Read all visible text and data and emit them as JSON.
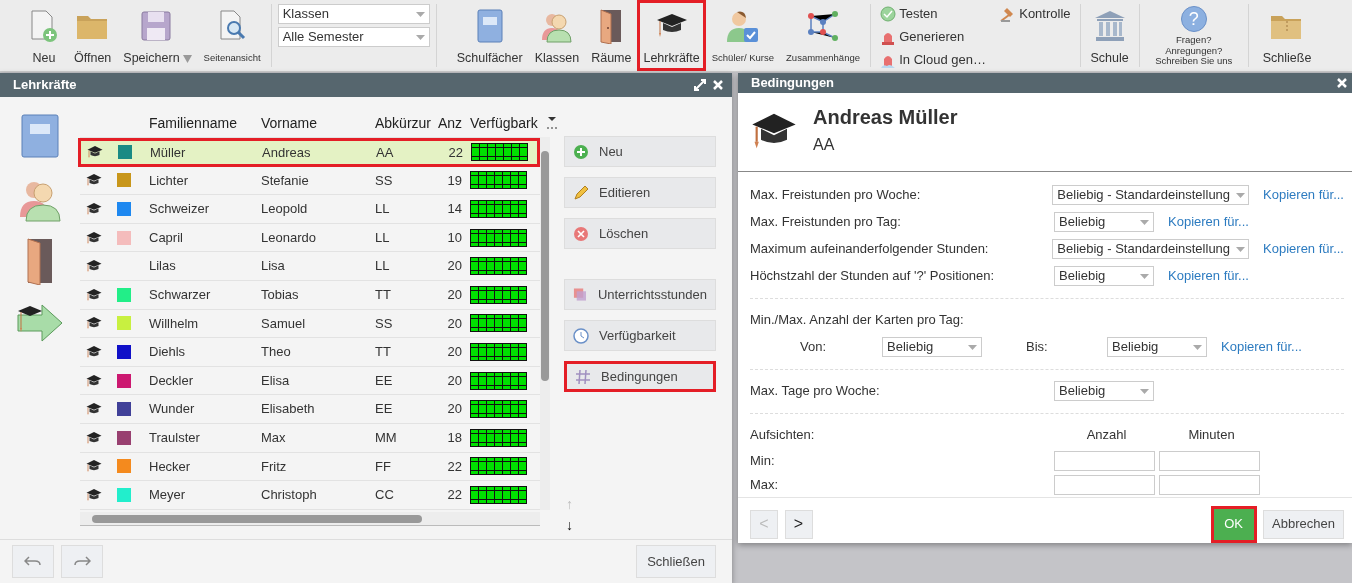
{
  "toolbar": {
    "file_buttons": [
      {
        "label": "Neu",
        "kind": "large",
        "dropdown": false
      },
      {
        "label": "Öffnen",
        "kind": "large",
        "dropdown": false
      },
      {
        "label": "Speichern",
        "kind": "large",
        "dropdown": true
      },
      {
        "label": "Seitenansicht",
        "kind": "small",
        "dropdown": false
      }
    ],
    "filters": [
      {
        "value": "Klassen"
      },
      {
        "value": "Alle Semester"
      }
    ],
    "view_buttons": [
      {
        "label": "Schulfächer",
        "kind": "large",
        "highlighted": false
      },
      {
        "label": "Klassen",
        "kind": "large",
        "highlighted": false
      },
      {
        "label": "Räume",
        "kind": "large",
        "highlighted": false
      },
      {
        "label": "Lehrkräfte",
        "kind": "large",
        "highlighted": true
      },
      {
        "label": "Schüler/ Kurse",
        "kind": "small",
        "highlighted": false
      },
      {
        "label": "Zusammenhänge",
        "kind": "small",
        "highlighted": false
      }
    ],
    "actions": [
      {
        "label": "Testen"
      },
      {
        "label": "Generieren"
      },
      {
        "label": "In Cloud gen…"
      },
      {
        "label": "Kontrolle"
      }
    ],
    "school": "Schule",
    "help_icon": "?",
    "feedback_lines": [
      "Fragen?",
      "Anregungen?",
      "Schreiben Sie uns"
    ],
    "close": "Schließe"
  },
  "teachers_window": {
    "title": "Lehrkräfte",
    "columns": [
      "Familienname",
      "Vorname",
      "Abkürzur",
      "Anz",
      "Verfügbark"
    ],
    "rows": [
      {
        "last": "Müller",
        "first": "Andreas",
        "short": "AA",
        "count": "22",
        "color": "#1a8a84",
        "selected": true
      },
      {
        "last": "Lichter",
        "first": "Stefanie",
        "short": "SS",
        "count": "19",
        "color": "#c8961a",
        "selected": false
      },
      {
        "last": "Schweizer",
        "first": "Leopold",
        "short": "LL",
        "count": "14",
        "color": "#1e88f0",
        "selected": false
      },
      {
        "last": "Capril",
        "first": "Leonardo",
        "short": "LL",
        "count": "10",
        "color": "#f4bcbc",
        "selected": false
      },
      {
        "last": "Lilas",
        "first": "Lisa",
        "short": "LL",
        "count": "20",
        "selected": false
      },
      {
        "last": "Schwarzer",
        "first": "Tobias",
        "short": "TT",
        "count": "20",
        "color": "#22ee88",
        "selected": false
      },
      {
        "last": "Willhelm",
        "first": "Samuel",
        "short": "SS",
        "count": "20",
        "color": "#c8f040",
        "selected": false
      },
      {
        "last": "Diehls",
        "first": "Theo",
        "short": "TT",
        "count": "20",
        "color": "#1010c8",
        "selected": false
      },
      {
        "last": "Deckler",
        "first": "Elisa",
        "short": "EE",
        "count": "20",
        "color": "#cc1870",
        "selected": false
      },
      {
        "last": "Wunder",
        "first": "Elisabeth",
        "short": "EE",
        "count": "20",
        "color": "#404098",
        "selected": false
      },
      {
        "last": "Traulster",
        "first": "Max",
        "short": "MM",
        "count": "18",
        "color": "#984070",
        "selected": false
      },
      {
        "last": "Hecker",
        "first": "Fritz",
        "short": "FF",
        "count": "22",
        "color": "#f48a1e",
        "selected": false
      },
      {
        "last": "Meyer",
        "first": "Christoph",
        "short": "CC",
        "count": "22",
        "color": "#22eecc",
        "selected": false
      }
    ],
    "actions": [
      {
        "label": "Neu",
        "highlighted": false
      },
      {
        "label": "Editieren",
        "highlighted": false
      },
      {
        "label": "Löschen",
        "highlighted": false
      }
    ],
    "details": [
      {
        "label": "Unterrichtsstunden",
        "highlighted": false
      },
      {
        "label": "Verfügbarkeit",
        "highlighted": false
      },
      {
        "label": "Bedingungen",
        "highlighted": true
      }
    ],
    "order_arrows": [
      {
        "label": "↑",
        "disabled": true
      },
      {
        "label": "↓",
        "disabled": false
      }
    ],
    "close_button": "Schließen"
  },
  "conditions_window": {
    "title": "Bedingungen",
    "teacher_name": "Andreas Müller",
    "teacher_short": "AA",
    "limits": [
      {
        "label": "Max. Freistunden pro Woche:",
        "value": "Beliebig - Standardeinstellung",
        "copy_link": "Kopieren für..."
      },
      {
        "label": "Max. Freistunden pro Tag:",
        "value": "Beliebig",
        "copy_link": "Kopieren für..."
      },
      {
        "label": "Maximum aufeinanderfolgender Stunden:",
        "value": "Beliebig - Standardeinstellung",
        "copy_link": "Kopieren für..."
      },
      {
        "label": "Höchstzahl der Stunden auf '?' Positionen:",
        "value": "Beliebig",
        "copy_link": "Kopieren für..."
      }
    ],
    "cards": {
      "label": "Min./Max. Anzahl der Karten pro Tag:",
      "from_label": "Von:",
      "from_value": "Beliebig",
      "to_label": "Bis:",
      "to_value": "Beliebig",
      "copy_link": "Kopieren für..."
    },
    "days": {
      "label": "Max. Tage pro Woche:",
      "value": "Beliebig"
    },
    "supervision": {
      "label": "Aufsichten:",
      "columns": [
        "Anzahl",
        "Minuten"
      ],
      "rows": [
        {
          "label": "Min:"
        },
        {
          "label": "Max:"
        }
      ]
    },
    "nav": [
      {
        "label": "<",
        "disabled": true
      },
      {
        "label": ">",
        "disabled": false
      }
    ],
    "buttons": [
      {
        "label": "OK",
        "kind": "primary",
        "highlighted": true
      },
      {
        "label": "Abbrechen",
        "kind": "secondary",
        "highlighted": false
      }
    ]
  }
}
